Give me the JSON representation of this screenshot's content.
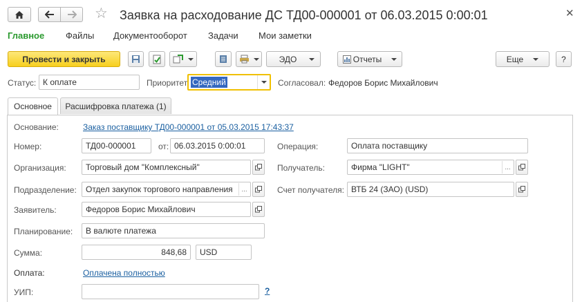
{
  "window": {
    "title": "Заявка на расходование ДС ТД00-000001 от 06.03.2015 0:00:01",
    "icons": {
      "home": "home-icon",
      "back": "arrow-left-icon",
      "forward": "arrow-right-icon",
      "favorite": "star-icon",
      "close": "close-icon"
    }
  },
  "menu": {
    "items": [
      "Главное",
      "Файлы",
      "Документооборот",
      "Задачи",
      "Мои заметки"
    ]
  },
  "toolbar": {
    "post_close_label": "Провести и закрыть",
    "edo_label": "ЭДО",
    "reports_label": "Отчеты",
    "more_label": "Еще",
    "help_label": "?"
  },
  "status_row": {
    "status_label": "Статус:",
    "status_value": "К оплате",
    "priority_label": "Приоритет:",
    "priority_value": "Средний",
    "approver_label": "Согласовал:",
    "approver_value": "Федоров Борис Михайлович"
  },
  "tabs": [
    {
      "label": "Основное",
      "active": true
    },
    {
      "label": "Расшифровка платежа (1)",
      "active": false
    }
  ],
  "form": {
    "basis_label": "Основание:",
    "basis_link": "Заказ поставщику ТД00-000001 от 05.03.2015 17:43:37",
    "number_label": "Номер:",
    "number_value": "ТД00-000001",
    "date_label": "от:",
    "date_value": "06.03.2015  0:00:01",
    "operation_label": "Операция:",
    "operation_value": "Оплата поставщику",
    "org_label": "Организация:",
    "org_value": "Торговый дом \"Комплексный\"",
    "recipient_label": "Получатель:",
    "recipient_value": "Фирма \"LIGHT\"",
    "division_label": "Подразделение:",
    "division_value": "Отдел закупок торгового направления",
    "account_label": "Счет получателя:",
    "account_value": "ВТБ 24 (ЗАО) (USD)",
    "applicant_label": "Заявитель:",
    "applicant_value": "Федоров Борис Михайлович",
    "planning_label": "Планирование:",
    "planning_value": "В валюте платежа",
    "amount_label": "Сумма:",
    "amount_value": "848,68",
    "currency_value": "USD",
    "payment_label": "Оплата:",
    "payment_link": "Оплачена полностью",
    "uip_label": "УИП:",
    "uip_value": "",
    "uip_help": "?"
  },
  "colors": {
    "accent_green": "#2b9a2f",
    "primary_button": "#f7cf1e",
    "link": "#1a5fa0",
    "focus_border": "#f0c000",
    "selection": "#3468c0"
  }
}
